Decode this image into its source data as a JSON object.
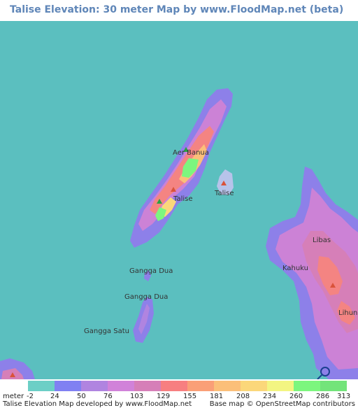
{
  "title": "Talise Elevation: 30 meter Map by www.FloodMap.net (beta)",
  "map": {
    "sea_color": "#5bbfbf",
    "places": [
      {
        "name": "Aer Banua"
      },
      {
        "name": "Talise"
      },
      {
        "name": "Talise"
      },
      {
        "name": "Libas"
      },
      {
        "name": "Kahuku"
      },
      {
        "name": "Lihunu"
      },
      {
        "name": "Gangga Dua"
      },
      {
        "name": "Gangga Dua"
      },
      {
        "name": "Gangga Satu"
      }
    ],
    "icons": [
      "peak-marker-icon",
      "osm-logo-icon"
    ]
  },
  "legend": {
    "unit_label": "meter",
    "ticks": [
      "-2",
      "24",
      "50",
      "76",
      "103",
      "129",
      "155",
      "181",
      "208",
      "234",
      "260",
      "286",
      "313"
    ],
    "colors": [
      "#6ccfc6",
      "#8080f2",
      "#b084e0",
      "#d182d9",
      "#d67fb8",
      "#f77f80",
      "#fa9f77",
      "#fbbf79",
      "#fbd77a",
      "#f3f582",
      "#7cf67e",
      "#73e47a"
    ]
  },
  "credits": {
    "left": "Talise Elevation Map developed by www.FloodMap.net",
    "right": "Base map © OpenStreetMap contributors"
  }
}
